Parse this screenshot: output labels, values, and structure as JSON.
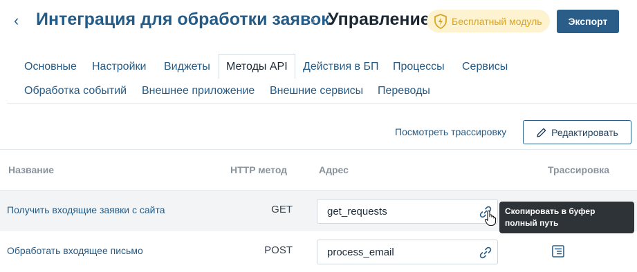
{
  "header": {
    "title": "Интеграция для обработки заявок",
    "current": "Управление",
    "badge": "Бесплатный модуль",
    "export_label": "Экспорт"
  },
  "tabs": [
    {
      "label": "Основные"
    },
    {
      "label": "Настройки"
    },
    {
      "label": "Виджеты"
    },
    {
      "label": "Методы API",
      "active": true
    },
    {
      "label": "Действия в БП"
    },
    {
      "label": "Процессы"
    },
    {
      "label": "Сервисы"
    },
    {
      "label": "Обработка событий"
    },
    {
      "label": "Внешнее приложение"
    },
    {
      "label": "Внешние сервисы"
    },
    {
      "label": "Переводы"
    }
  ],
  "toolbar": {
    "trace_link": "Посмотреть трассировку",
    "edit_label": "Редактировать"
  },
  "table": {
    "columns": {
      "name": "Название",
      "method": "HTTP метод",
      "address": "Адрес",
      "trace": "Трассировка"
    },
    "rows": [
      {
        "name": "Получить входящие заявки с сайта",
        "method": "GET",
        "address": "get_requests",
        "trace_enabled": false
      },
      {
        "name": "Обработать входящее письмо",
        "method": "POST",
        "address": "process_email",
        "trace_enabled": true
      }
    ]
  },
  "tooltip": {
    "text": "Скопировать в буфер полный путь"
  },
  "colors": {
    "accent": "#2a5d88",
    "link": "#245b87",
    "badge_bg": "#fdf3d1",
    "badge_fg": "#d9a520"
  }
}
